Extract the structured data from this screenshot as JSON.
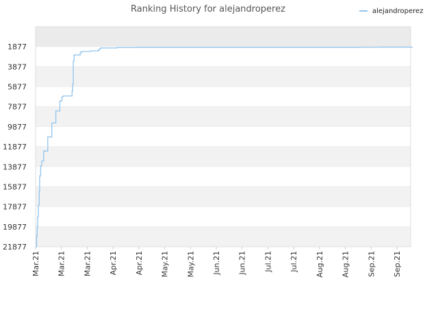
{
  "chart_data": {
    "type": "line",
    "title": "Ranking History for alejandroperez",
    "xlabel": "",
    "ylabel": "",
    "x_ticks": [
      "Mar.21",
      "Mar.21",
      "Mar.21",
      "Apr.21",
      "Apr.21",
      "May.21",
      "May.21",
      "Jun.21",
      "Jun.21",
      "Jul.21",
      "Jul.21",
      "Aug.21",
      "Aug.21",
      "Sep.21",
      "Sep.21"
    ],
    "y_ticks": [
      1877,
      3877,
      5877,
      7877,
      9877,
      11877,
      13877,
      15877,
      17877,
      19877,
      21877
    ],
    "ylim": [
      21877,
      -123
    ],
    "xlim": [
      0,
      185
    ],
    "y_inverted": true,
    "grid": "horizontal alternating bands",
    "legend": "top-right",
    "colors": {
      "line": "#90c4ee",
      "band_dark": "#f2f2f2",
      "band_light": "#ffffff",
      "band_top": "#ebebeb"
    },
    "series": [
      {
        "name": "alejandroperez",
        "x": [
          0,
          0.5,
          0.8,
          1,
          1.4,
          1.8,
          2,
          2.5,
          3,
          4,
          6,
          8,
          10,
          12,
          13,
          13.5,
          14,
          15,
          17,
          18,
          18.3,
          18.6,
          19,
          19.5,
          19.8,
          20,
          21,
          22,
          22.3,
          23,
          26,
          27,
          30,
          31,
          31.5,
          32,
          34,
          40,
          50,
          60,
          70,
          80,
          90,
          100,
          110,
          120,
          130,
          140,
          150,
          155,
          160,
          170,
          180,
          186
        ],
        "y": [
          21877,
          20800,
          19900,
          18900,
          17700,
          16300,
          14800,
          13800,
          13300,
          12300,
          10900,
          9500,
          8300,
          7300,
          6900,
          6800,
          6800,
          6800,
          6800,
          6300,
          5600,
          3300,
          2700,
          2700,
          2700,
          2700,
          2700,
          2500,
          2400,
          2350,
          2350,
          2300,
          2300,
          2200,
          2100,
          2000,
          2000,
          1960,
          1950,
          1950,
          1950,
          1950,
          1950,
          1950,
          1950,
          1950,
          1950,
          1950,
          1950,
          1950,
          1930,
          1920,
          1920,
          1920
        ]
      }
    ]
  }
}
